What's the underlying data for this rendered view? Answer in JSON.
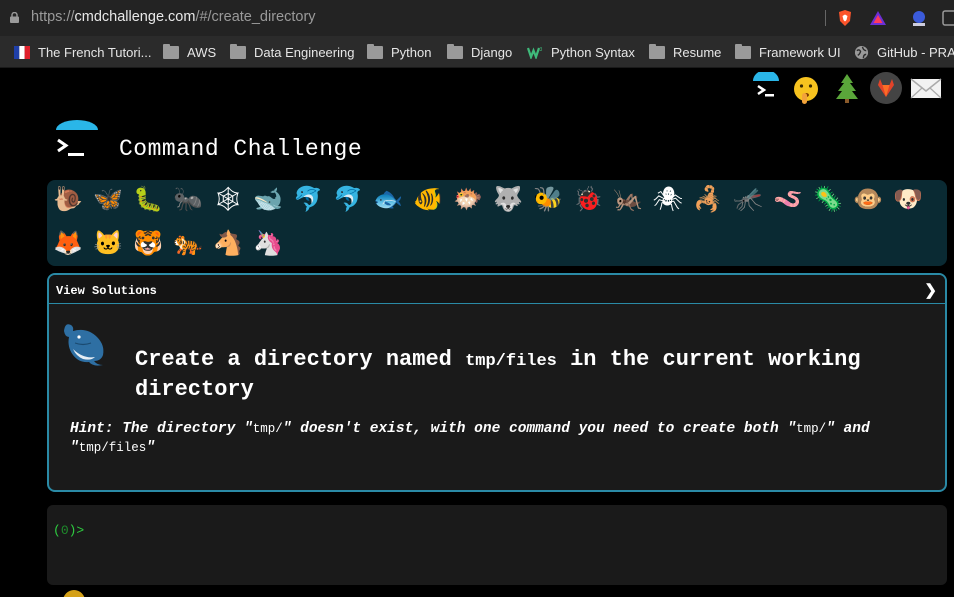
{
  "browser": {
    "url_scheme": "https://",
    "url_host": "cmdchallenge.com",
    "url_path": "/#/create_directory",
    "extensions": [
      "brave-shield-icon",
      "brave-rewards-icon",
      "extension-icon",
      "extension-icon-2"
    ]
  },
  "bookmarks": [
    {
      "label": "The French Tutori...",
      "icon": "french-flag-icon"
    },
    {
      "label": "AWS",
      "icon": "folder-icon"
    },
    {
      "label": "Data Engineering",
      "icon": "folder-icon"
    },
    {
      "label": "Python",
      "icon": "folder-icon"
    },
    {
      "label": "Django",
      "icon": "folder-icon"
    },
    {
      "label": "Python Syntax",
      "icon": "w3schools-icon"
    },
    {
      "label": "Resume",
      "icon": "folder-icon"
    },
    {
      "label": "Framework UI",
      "icon": "folder-icon"
    },
    {
      "label": "GitHub - PRAT",
      "icon": "globe-icon"
    }
  ],
  "header": {
    "title": "Command Challenge",
    "top_icons": [
      "terminal-logo-icon",
      "shushing-face-icon",
      "tree-icon",
      "gitlab-icon",
      "mail-icon"
    ]
  },
  "animals": [
    "🐌",
    "🦋",
    "🐛",
    "🐜",
    "🕸",
    "🐋",
    "🐬",
    "🐬",
    "🐟",
    "🐠",
    "🐡",
    "🐺",
    "🐝",
    "🐞",
    "🦗",
    "🕷",
    "🦂",
    "🦟",
    "🪱",
    "🦠",
    "🐵",
    "🐶",
    "🦊",
    "🐱",
    "🐯",
    "🐅",
    "🐴",
    "🦄"
  ],
  "challenge": {
    "view_solutions": "View Solutions",
    "chevron": "❯",
    "title_part1": "Create a directory named ",
    "title_code": "tmp/files",
    "title_part2": " in the current working directory",
    "hint_part1": "Hint: The directory \"",
    "hint_code1": "tmp/",
    "hint_part2": "\" doesn't exist, with one command you need to create both \"",
    "hint_code2": "tmp/",
    "hint_part3": "\" and \"",
    "hint_code3": "tmp/files",
    "hint_part4": "\""
  },
  "terminal": {
    "prompt_open": "(",
    "prompt_num": "0",
    "prompt_close": ")>"
  },
  "colors": {
    "accent": "#2a8aa6",
    "animals_bg": "#0a2a33",
    "prompt_green": "#2ecc40"
  }
}
